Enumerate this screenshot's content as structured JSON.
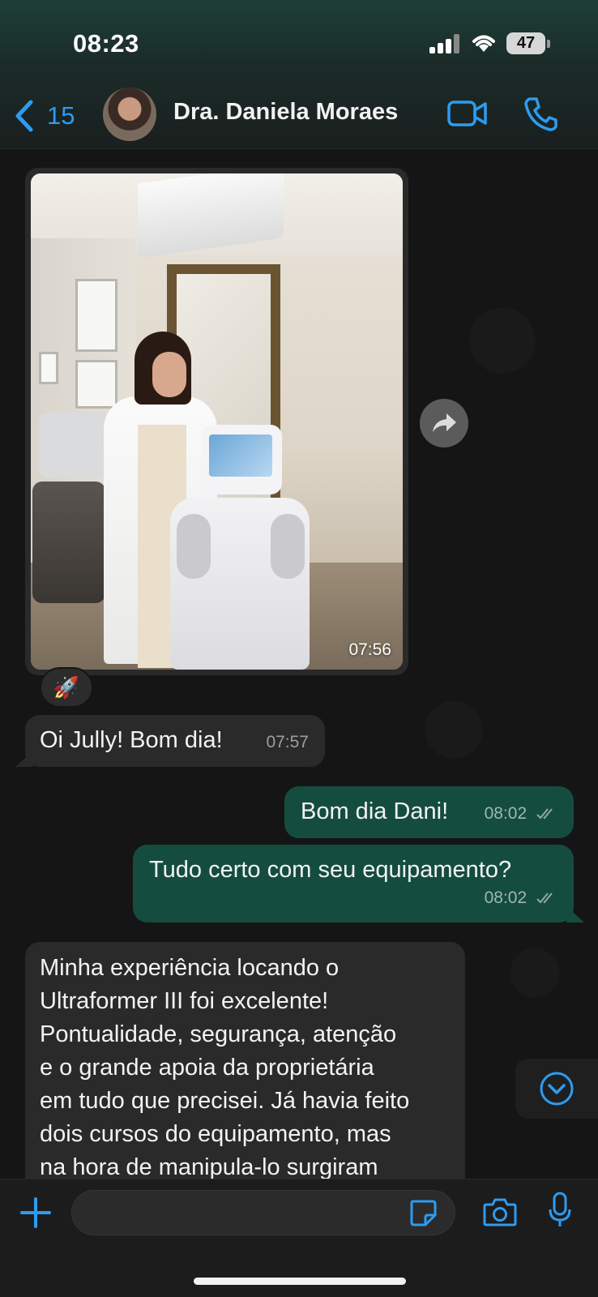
{
  "status_bar": {
    "time": "08:23",
    "battery": "47"
  },
  "header": {
    "back_count": "15",
    "contact_name": "Dra. Daniela Moraes",
    "icons": [
      "chevron-left-icon",
      "video-camera-icon",
      "phone-icon"
    ]
  },
  "messages": [
    {
      "type": "image",
      "direction": "incoming",
      "time": "07:56",
      "reaction": "🚀"
    },
    {
      "type": "text",
      "direction": "incoming",
      "text": "Oi Jully! Bom dia!",
      "time": "07:57"
    },
    {
      "type": "text",
      "direction": "outgoing",
      "text": "Bom dia Dani!",
      "time": "08:02",
      "status": "read"
    },
    {
      "type": "text",
      "direction": "outgoing",
      "text": "Tudo certo com seu equipamento?",
      "time": "08:02",
      "status": "read"
    },
    {
      "type": "text",
      "direction": "incoming",
      "lines": [
        "Minha experiência locando o",
        "Ultraformer III foi excelente!",
        "Pontualidade, segurança, atenção",
        "e o grande apoia da proprietária",
        "em tudo que precisei. Já havia feito",
        "dois cursos do equipamento, mas",
        "na hora de manipula-lo surgiram"
      ]
    }
  ],
  "input": {
    "placeholder": ""
  },
  "colors": {
    "accent": "#2d9cf0",
    "outgoing_bubble": "#144d3f",
    "incoming_bubble": "#2a2a2a"
  }
}
